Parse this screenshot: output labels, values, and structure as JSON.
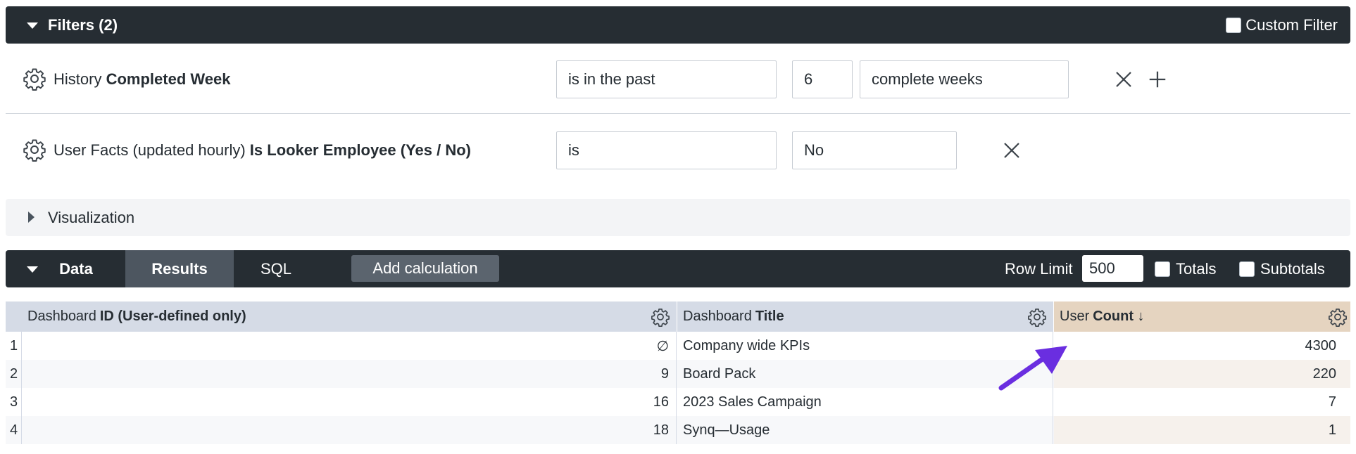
{
  "filters": {
    "title": "Filters (2)",
    "custom_filter_label": "Custom Filter",
    "rows": [
      {
        "view": "History",
        "field": "Completed Week",
        "operator": "is in the past",
        "value": "6",
        "unit": "complete weeks"
      },
      {
        "view": "User Facts (updated hourly)",
        "field": "Is Looker Employee (Yes / No)",
        "operator": "is",
        "value": "No"
      }
    ]
  },
  "visualization": {
    "title": "Visualization"
  },
  "data_panel": {
    "title": "Data",
    "tabs": [
      "Results",
      "SQL"
    ],
    "add_calculation": "Add calculation",
    "row_limit_label": "Row Limit",
    "row_limit_value": "500",
    "totals_label": "Totals",
    "subtotals_label": "Subtotals"
  },
  "table": {
    "columns": [
      {
        "view": "Dashboard",
        "field": "ID (User-defined only)"
      },
      {
        "view": "Dashboard",
        "field": "Title"
      },
      {
        "view": "User",
        "field": "Count ↓"
      }
    ],
    "rows": [
      {
        "num": "1",
        "id": "∅",
        "title": "Company wide KPIs",
        "count": "4300"
      },
      {
        "num": "2",
        "id": "9",
        "title": "Board Pack",
        "count": "220"
      },
      {
        "num": "3",
        "id": "16",
        "title": "2023 Sales Campaign",
        "count": "7"
      },
      {
        "num": "4",
        "id": "18",
        "title": "Synq—Usage",
        "count": "1"
      }
    ]
  },
  "colors": {
    "dark_bar": "#262d33",
    "dimension_header": "#d5dbe6",
    "measure_header": "#e5d4c0",
    "arrow": "#6a2ee0"
  }
}
